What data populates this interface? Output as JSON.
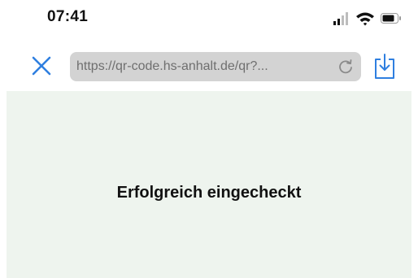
{
  "status_bar": {
    "time": "07:41",
    "icons": [
      "signal-icon",
      "wifi-icon",
      "battery-icon"
    ]
  },
  "toolbar": {
    "close_icon": "close-icon",
    "url": "https://qr-code.hs-anhalt.de/qr?...",
    "reload_icon": "reload-icon",
    "share_icon": "share-icon",
    "accent_color": "#2f7fe0"
  },
  "content": {
    "message": "Erfolgreich eingecheckt",
    "background_color": "#eef4ee"
  }
}
